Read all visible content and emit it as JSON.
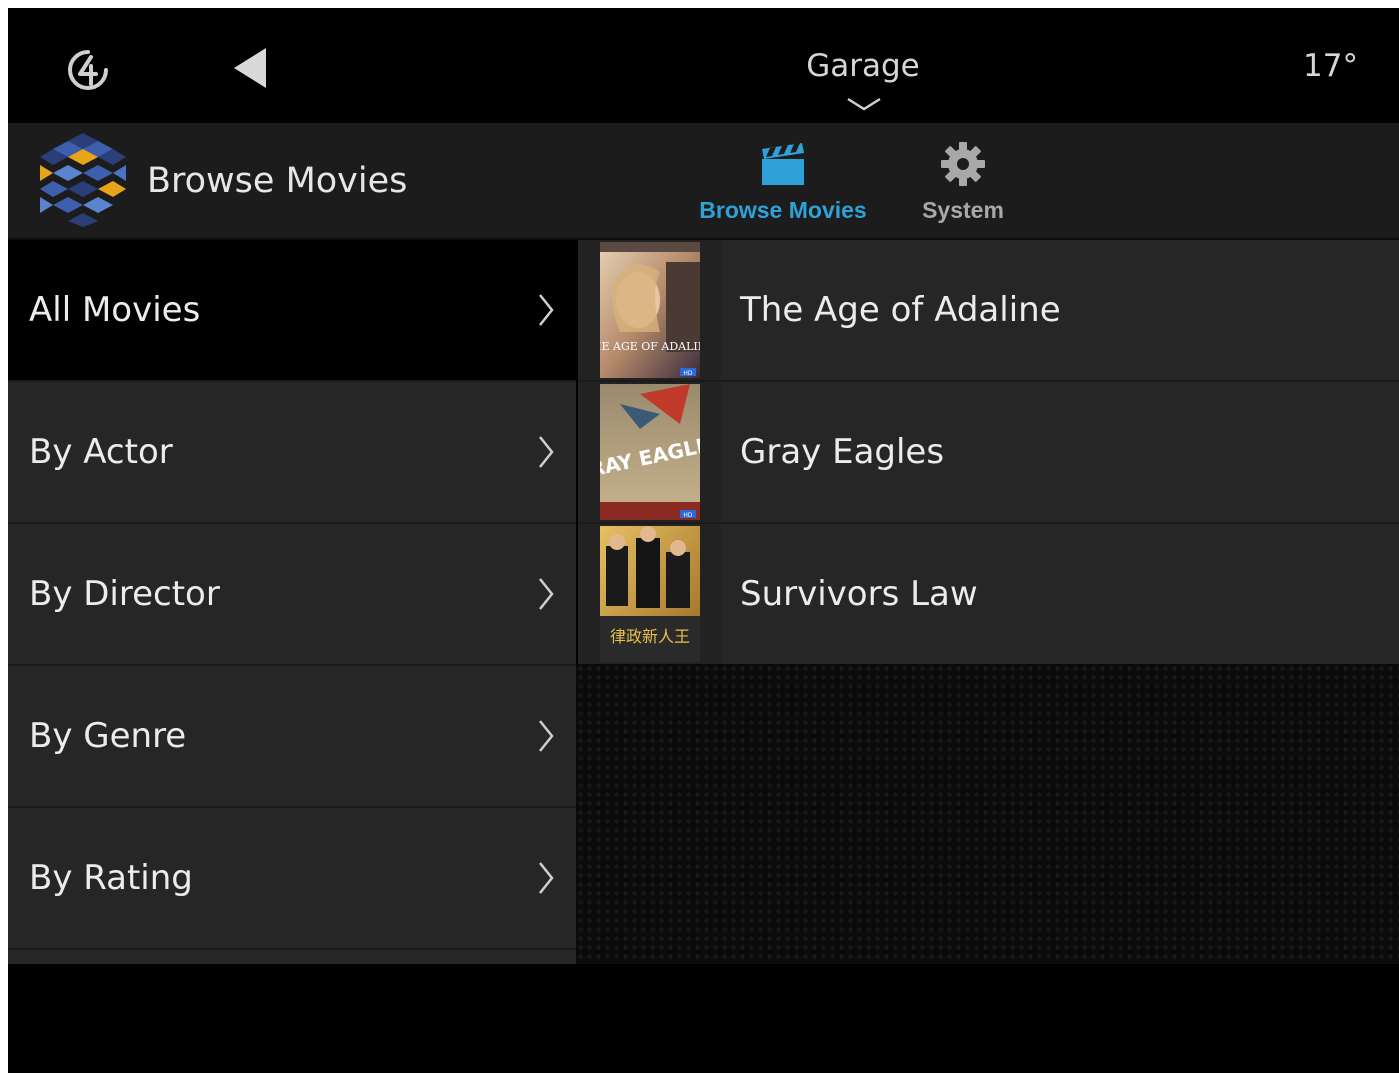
{
  "topbar": {
    "room": "Garage",
    "temperature": "17°",
    "logo_icon": "control4-logo-icon",
    "back_icon": "back-arrow-icon",
    "room_dropdown_icon": "chevron-down-icon"
  },
  "header": {
    "title": "Browse Movies",
    "logo_icon": "movies-app-logo-icon",
    "tabs": [
      {
        "label": "Browse Movies",
        "icon": "clapperboard-icon",
        "active": true,
        "color": "#2ea2d8"
      },
      {
        "label": "System",
        "icon": "gear-icon",
        "active": false,
        "color": "#a8a8a8"
      }
    ]
  },
  "menu": {
    "items": [
      {
        "label": "All Movies",
        "active": true
      },
      {
        "label": "By Actor",
        "active": false
      },
      {
        "label": "By Director",
        "active": false
      },
      {
        "label": "By Genre",
        "active": false
      },
      {
        "label": "By Rating",
        "active": false
      }
    ],
    "chevron_icon": "chevron-right-icon"
  },
  "movies": [
    {
      "title": "The Age of Adaline",
      "poster_text": "THE AGE OF ADALINE",
      "badge": "HD"
    },
    {
      "title": "Gray Eagles",
      "poster_text": "GRAY EAGLES",
      "badge": "HD"
    },
    {
      "title": "Survivors Law",
      "poster_text": "律政新人王",
      "badge": ""
    }
  ],
  "colors": {
    "accent": "#2ea2d8",
    "background": "#000000",
    "panel": "#262626",
    "header": "#1c1c1c"
  }
}
